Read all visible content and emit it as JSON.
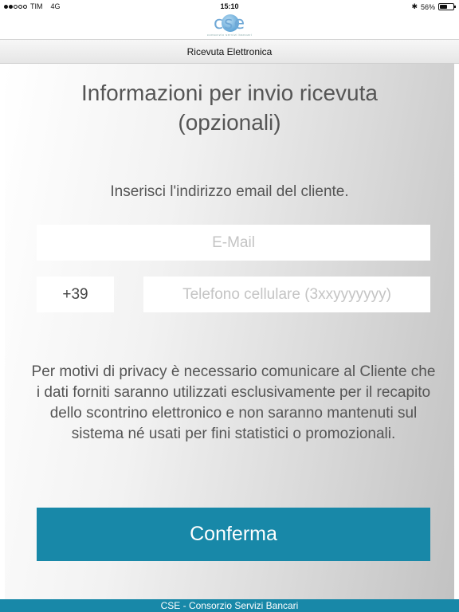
{
  "status_bar": {
    "carrier": "TIM",
    "network": "4G",
    "time": "15:10",
    "battery": "56%",
    "battery_level": 0.56,
    "signal_bars_filled": 2,
    "signal_bars_total": 5
  },
  "header": {
    "logo_text": "CSE",
    "logo_subtext": "consorzio servizi bancari"
  },
  "titlebar": {
    "title": "Ricevuta Elettronica"
  },
  "main": {
    "heading_line1": "Informazioni per invio ricevuta",
    "heading_line2": "(opzionali)",
    "instruction": "Inserisci l'indirizzo email del cliente.",
    "email_placeholder": "E-Mail",
    "phone_prefix": "+39",
    "phone_placeholder": "Telefono cellulare (3xxyyyyyyy)",
    "privacy_text": "Per motivi di privacy è necessario comunicare al Cliente che i dati forniti saranno utilizzati esclusivamente per il recapito dello scontrino elettronico e non saranno mantenuti sul sistema né usati per fini statistici o promozionali.",
    "confirm_label": "Conferma"
  },
  "footer": {
    "text": "CSE - Consorzio Servizi Bancari"
  },
  "colors": {
    "accent": "#1888a8",
    "logo": "#5d9fd2"
  }
}
